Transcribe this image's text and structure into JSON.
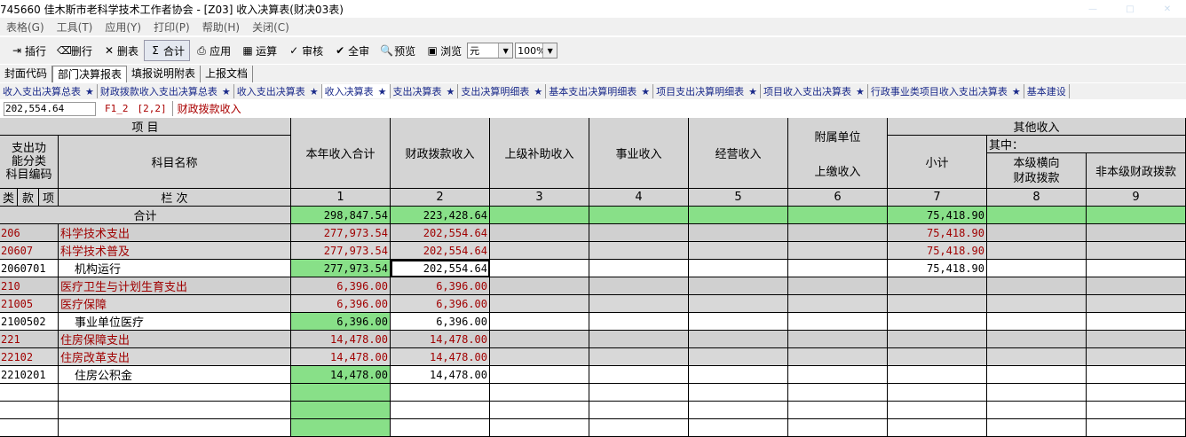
{
  "titlebar": {
    "title": "745660  佳木斯市老科学技术工作者协会 - [Z03] 收入决算表(财决03表)"
  },
  "menubar": {
    "items": [
      "表格(G)",
      "工具(T)",
      "应用(Y)",
      "打印(P)",
      "帮助(H)",
      "关闭(C)"
    ]
  },
  "toolbar": {
    "buttons": [
      {
        "label": "插行",
        "icon": "insert-row-icon",
        "glyph": "⇥"
      },
      {
        "label": "删行",
        "icon": "delete-row-icon",
        "glyph": "⌫"
      },
      {
        "label": "删表",
        "icon": "delete-table-icon",
        "glyph": "✕"
      },
      {
        "label": "合计",
        "icon": "sum-icon",
        "glyph": "Σ"
      },
      {
        "label": "应用",
        "icon": "apply-icon",
        "glyph": "⎙"
      },
      {
        "label": "运算",
        "icon": "calculate-icon",
        "glyph": "▦"
      },
      {
        "label": "审核",
        "icon": "audit-icon",
        "glyph": "✓"
      },
      {
        "label": "全审",
        "icon": "full-audit-icon",
        "glyph": "✔"
      },
      {
        "label": "预览",
        "icon": "preview-icon",
        "glyph": "🔍"
      },
      {
        "label": "浏览",
        "icon": "browse-icon",
        "glyph": "▣"
      }
    ],
    "unit": "元",
    "zoom": "100%"
  },
  "reporttabs": [
    "封面代码",
    "部门决算报表",
    "填报说明附表",
    "上报文档"
  ],
  "sheettabs": [
    "收入支出决算总表",
    "财政拨款收入支出决算总表",
    "收入支出决算表",
    "收入决算表",
    "支出决算表",
    "支出决算明细表",
    "基本支出决算明细表",
    "项目支出决算明细表",
    "项目收入支出决算表",
    "行政事业类项目收入支出决算表",
    "基本建设"
  ],
  "formula": {
    "value": "202,554.64",
    "cellref": "F1_2",
    "pos": "[2,2]",
    "caption": "财政拨款收入"
  },
  "grid": {
    "header": {
      "item": "项          目",
      "code_col": "支出功能分类科目编码",
      "code_col_l1": "支出功",
      "code_col_l2": "能分类",
      "code_col_l3": "科目编码",
      "name_col": "科目名称",
      "lei": "类",
      "kuan": "款",
      "xiang": "项",
      "lanci": "栏          次",
      "c1": "本年收入合计",
      "c2": "财政拨款收入",
      "c3": "上级补助收入",
      "c4": "事业收入",
      "c5": "经营收入",
      "c6_l1": "附属单位",
      "c6_l2": "上缴收入",
      "other": "其他收入",
      "c7": "小计",
      "qizhong": "其中：",
      "c8_l1": "本级横向",
      "c8_l2": "财政拨款",
      "c9": "非本级财政拨款",
      "nums": [
        "1",
        "2",
        "3",
        "4",
        "5",
        "6",
        "7",
        "8",
        "9"
      ]
    },
    "total_label": "合计",
    "total": {
      "c1": "298,847.54",
      "c2": "223,428.64",
      "c7": "75,418.90"
    },
    "rows": [
      {
        "code": "206",
        "name": "科学技术支出",
        "c1": "277,973.54",
        "c2": "202,554.64",
        "c7": "75,418.90",
        "level": 1
      },
      {
        "code": "20607",
        "name": "科学技术普及",
        "c1": "277,973.54",
        "c2": "202,554.64",
        "c7": "75,418.90",
        "level": 2
      },
      {
        "code": "2060701",
        "name": "机构运行",
        "c1": "277,973.54",
        "c2": "202,554.64",
        "c7": "75,418.90",
        "level": 3
      },
      {
        "code": "210",
        "name": "医疗卫生与计划生育支出",
        "c1": "6,396.00",
        "c2": "6,396.00",
        "c7": "",
        "level": 1
      },
      {
        "code": "21005",
        "name": "医疗保障",
        "c1": "6,396.00",
        "c2": "6,396.00",
        "c7": "",
        "level": 2
      },
      {
        "code": "2100502",
        "name": "事业单位医疗",
        "c1": "6,396.00",
        "c2": "6,396.00",
        "c7": "",
        "level": 3
      },
      {
        "code": "221",
        "name": "住房保障支出",
        "c1": "14,478.00",
        "c2": "14,478.00",
        "c7": "",
        "level": 1
      },
      {
        "code": "22102",
        "name": "住房改革支出",
        "c1": "14,478.00",
        "c2": "14,478.00",
        "c7": "",
        "level": 2
      },
      {
        "code": "2210201",
        "name": "住房公积金",
        "c1": "14,478.00",
        "c2": "14,478.00",
        "c7": "",
        "level": 3
      }
    ]
  }
}
